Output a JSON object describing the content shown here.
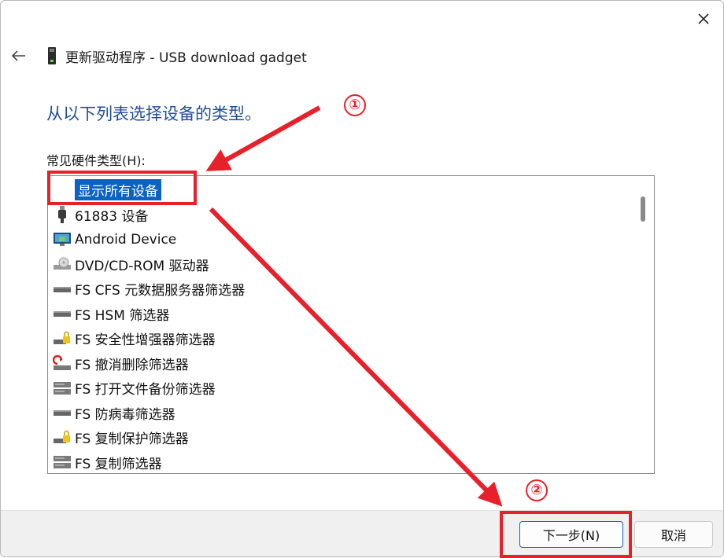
{
  "window": {
    "title": "更新驱动程序 - USB download gadget"
  },
  "heading": "从以下列表选择设备的类型。",
  "list": {
    "label": "常见硬件类型(H):",
    "items": [
      {
        "label": "显示所有设备",
        "icon": "none",
        "selected": true
      },
      {
        "label": "61883 设备",
        "icon": "firewire-plug-icon"
      },
      {
        "label": "Android Device",
        "icon": "monitor-icon"
      },
      {
        "label": "DVD/CD-ROM 驱动器",
        "icon": "optical-drive-icon"
      },
      {
        "label": "FS CFS 元数据服务器筛选器",
        "icon": "drive-icon"
      },
      {
        "label": "FS HSM 筛选器",
        "icon": "drive-icon"
      },
      {
        "label": "FS 安全性增强器筛选器",
        "icon": "drive-lock-icon"
      },
      {
        "label": "FS 撤消删除筛选器",
        "icon": "drive-undelete-icon"
      },
      {
        "label": "FS 打开文件备份筛选器",
        "icon": "server-icon"
      },
      {
        "label": "FS 防病毒筛选器",
        "icon": "drive-icon"
      },
      {
        "label": "FS 复制保护筛选器",
        "icon": "drive-lock-icon"
      },
      {
        "label": "FS 复制筛选器",
        "icon": "server-icon"
      }
    ]
  },
  "buttons": {
    "next": "下一步(N)",
    "cancel": "取消"
  },
  "annotations": {
    "step1": "①",
    "step2": "②",
    "color": "#e8202a"
  },
  "colors": {
    "heading": "#1f4e9c",
    "selection": "#0b62c4"
  }
}
